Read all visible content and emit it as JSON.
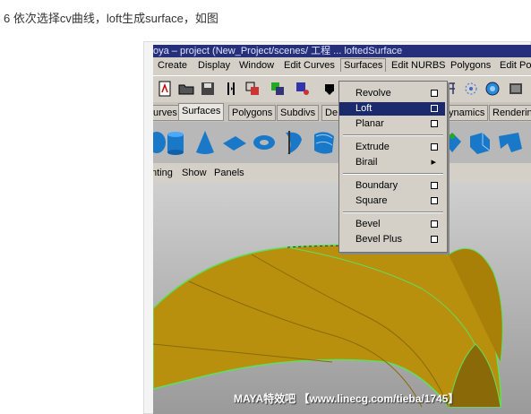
{
  "caption": "6 依次选择cv曲线，loft生成surface，如图",
  "window": {
    "title": "oya – project (New_Project/scenes/ 工程 ... loftedSurface"
  },
  "menubar": [
    "Create",
    "Display",
    "Window",
    "Edit Curves",
    "Surfaces",
    "Edit NURBS",
    "Polygons",
    "Edit Po"
  ],
  "shelf_tabs": [
    "urves",
    "Surfaces",
    "Polygons",
    "Subdivs",
    "De",
    "ynamics",
    "Renderin"
  ],
  "viewport_menu": [
    "nting",
    "Show",
    "Panels"
  ],
  "dropdown": {
    "items": [
      {
        "label": "Revolve",
        "option": true
      },
      {
        "label": "Loft",
        "option": true,
        "selected": true
      },
      {
        "label": "Planar",
        "option": true
      },
      {
        "label": "Extrude",
        "option": true
      },
      {
        "label": "Birail",
        "submenu": true
      },
      {
        "label": "Boundary",
        "option": true
      },
      {
        "label": "Square",
        "option": true
      },
      {
        "label": "Bevel",
        "option": true
      },
      {
        "label": "Bevel Plus",
        "option": true
      }
    ]
  },
  "watermark": "MAYA特效吧 【www.linecg.com/tieba/1745】",
  "colors": {
    "surface": "#b8900e",
    "wire": "#5ee05e",
    "menu_highlight": "#1a2a6c",
    "shelf_icon": "#1a78c8"
  }
}
